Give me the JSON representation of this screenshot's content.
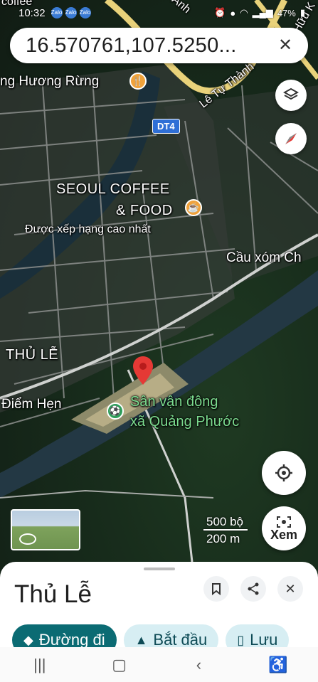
{
  "status_bar": {
    "time": "10:32",
    "app_icons": [
      "Zalo",
      "Zalo",
      "Zalo"
    ],
    "battery": "47%"
  },
  "search": {
    "value": "16.570761,107.5250...",
    "close_icon": "close-icon"
  },
  "map": {
    "labels": {
      "top_left": "coffee",
      "huong_rung": "ng Hương Rừng",
      "le_tu_thanh": "Lê Tự Thành",
      "road_top": "Anh",
      "hu_ki": "Hữu K",
      "dt4": "DT4",
      "seoul_line1": "SEOUL COFFEE",
      "seoul_line2": "& FOOD",
      "seoul_rating": "Được xếp hạng cao nhất",
      "cau_xom": "Cầu xóm Ch",
      "thu_le": "THỦ LỄ",
      "diem_hen": "Điểm Hẹn",
      "stadium_line1": "Sân vận động",
      "stadium_line2": "xã Quảng Phước"
    },
    "scale": {
      "imperial": "500 bộ",
      "metric": "200 m"
    },
    "street_view_label": "Xem"
  },
  "sheet": {
    "title": "Thủ Lễ",
    "chips": [
      {
        "label": "Đường đi",
        "icon": "directions-icon"
      },
      {
        "label": "Bắt đầu",
        "icon": "navigation-arrow-icon"
      },
      {
        "label": "Lưu",
        "icon": "bookmark-icon"
      }
    ]
  },
  "colors": {
    "primary_chip": "#0b6b73",
    "secondary_chip": "#d7eef3",
    "pin": "#e53935",
    "poi_orange": "#f0a23b",
    "poi_green": "#2e9e5a"
  }
}
